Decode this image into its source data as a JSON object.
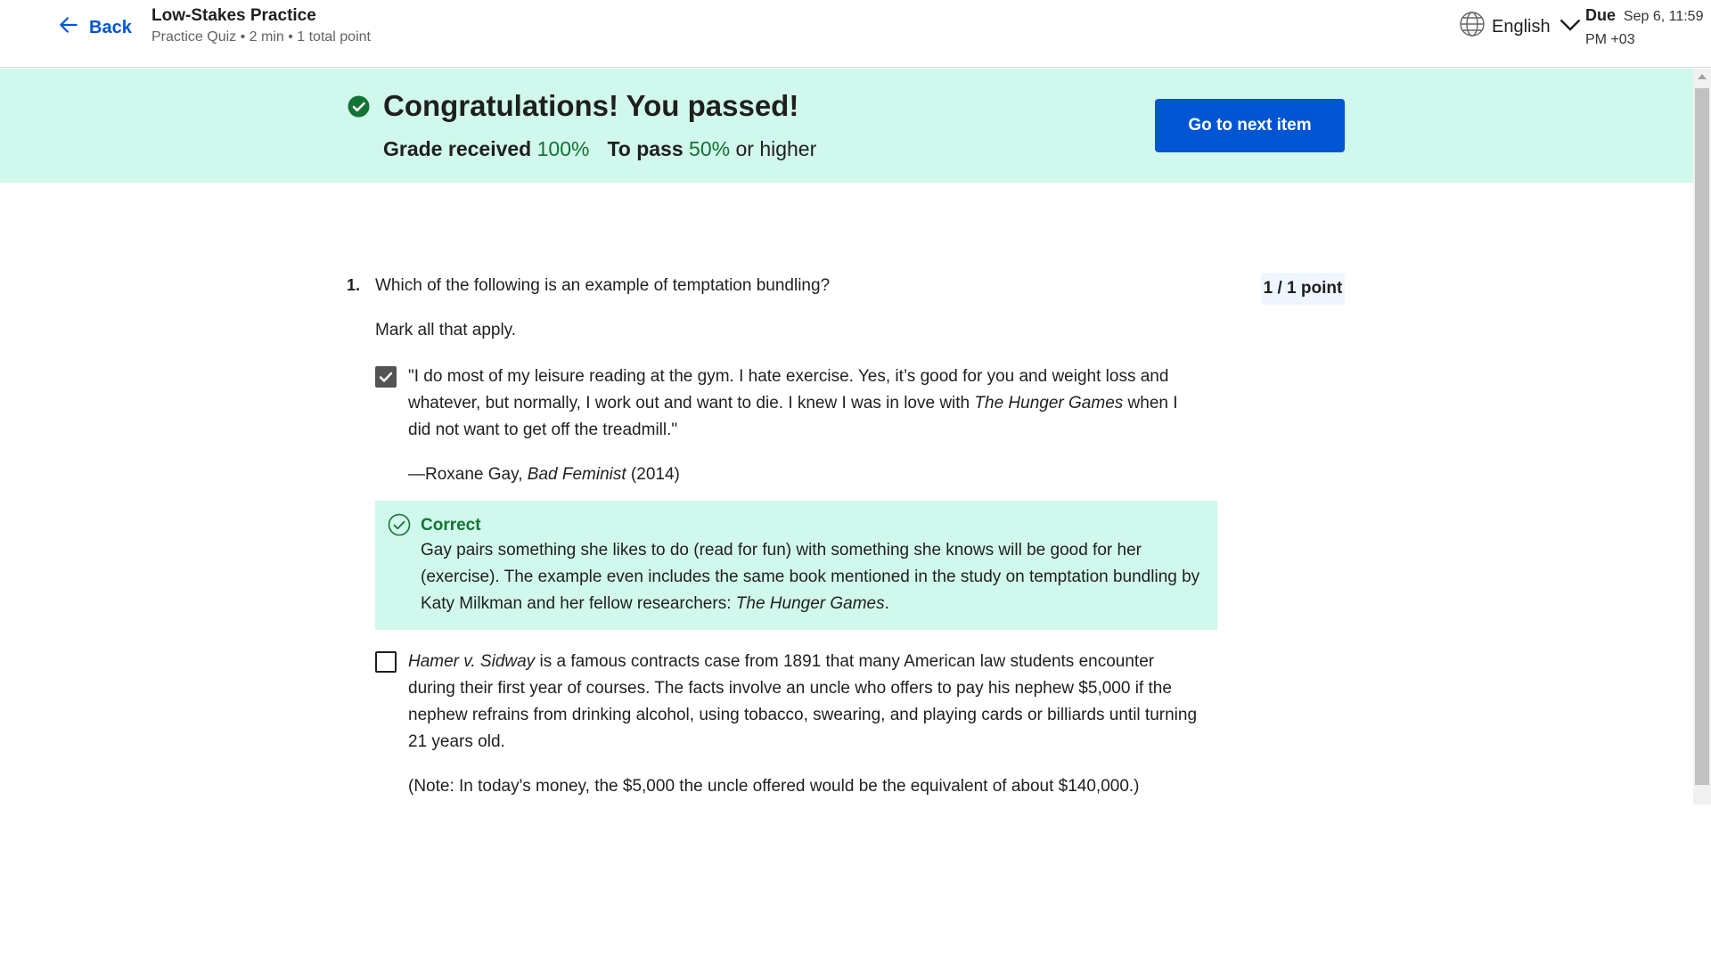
{
  "header": {
    "back_label": "Back",
    "title": "Low-Stakes Practice",
    "subtitle": "Practice Quiz • 2 min • 1 total point",
    "language": "English",
    "due_label": "Due",
    "due_value": "Sep 6, 11:59 PM +03"
  },
  "banner": {
    "title": "Congratulations! You passed!",
    "grade_label": "Grade received",
    "grade_value": "100%",
    "pass_label": "To pass",
    "pass_value": "50%",
    "pass_suffix": "or higher",
    "next_button": "Go to next item"
  },
  "question": {
    "number": "1.",
    "text": "Which of the following is an example of temptation bundling?",
    "points": "1 / 1 point",
    "instruction": "Mark all that apply.",
    "options": [
      {
        "checked": true,
        "text_a": "\"I do most of my leisure reading at the gym. I hate exercise. Yes, it’s good for you and weight loss and whatever, but normally, I work out and want to die. I knew I was in love with",
        "text_italic": "The Hunger Games",
        "text_b": "when I did not want to get off the treadmill.\"",
        "attribution_prefix": "—Roxane Gay,",
        "attribution_italic": "Bad Feminist",
        "attribution_suffix": "(2014)"
      },
      {
        "checked": false,
        "text_italic": "Hamer v. Sidway",
        "text_a": "is a famous contracts case from 1891 that many American law students encounter during their first year of courses. The facts involve an uncle who offers to pay his nephew $5,000 if the nephew refrains from drinking alcohol, using tobacco, swearing, and playing cards or billiards until turning 21 years old.",
        "note": "(Note: In today's money, the $5,000 the uncle offered would be the equivalent of about $140,000.)"
      }
    ],
    "feedback": {
      "title": "Correct",
      "text_a": "Gay pairs something she likes to do (read for fun) with something she knows will be good for her (exercise). The example even includes the same book mentioned in the study on temptation bundling by Katy Milkman and her fellow researchers:",
      "text_italic": "The Hunger Games",
      "text_b": "."
    }
  },
  "colors": {
    "accent": "#0056d2",
    "success_bg": "#d1f8ec",
    "success_text": "#137333"
  }
}
